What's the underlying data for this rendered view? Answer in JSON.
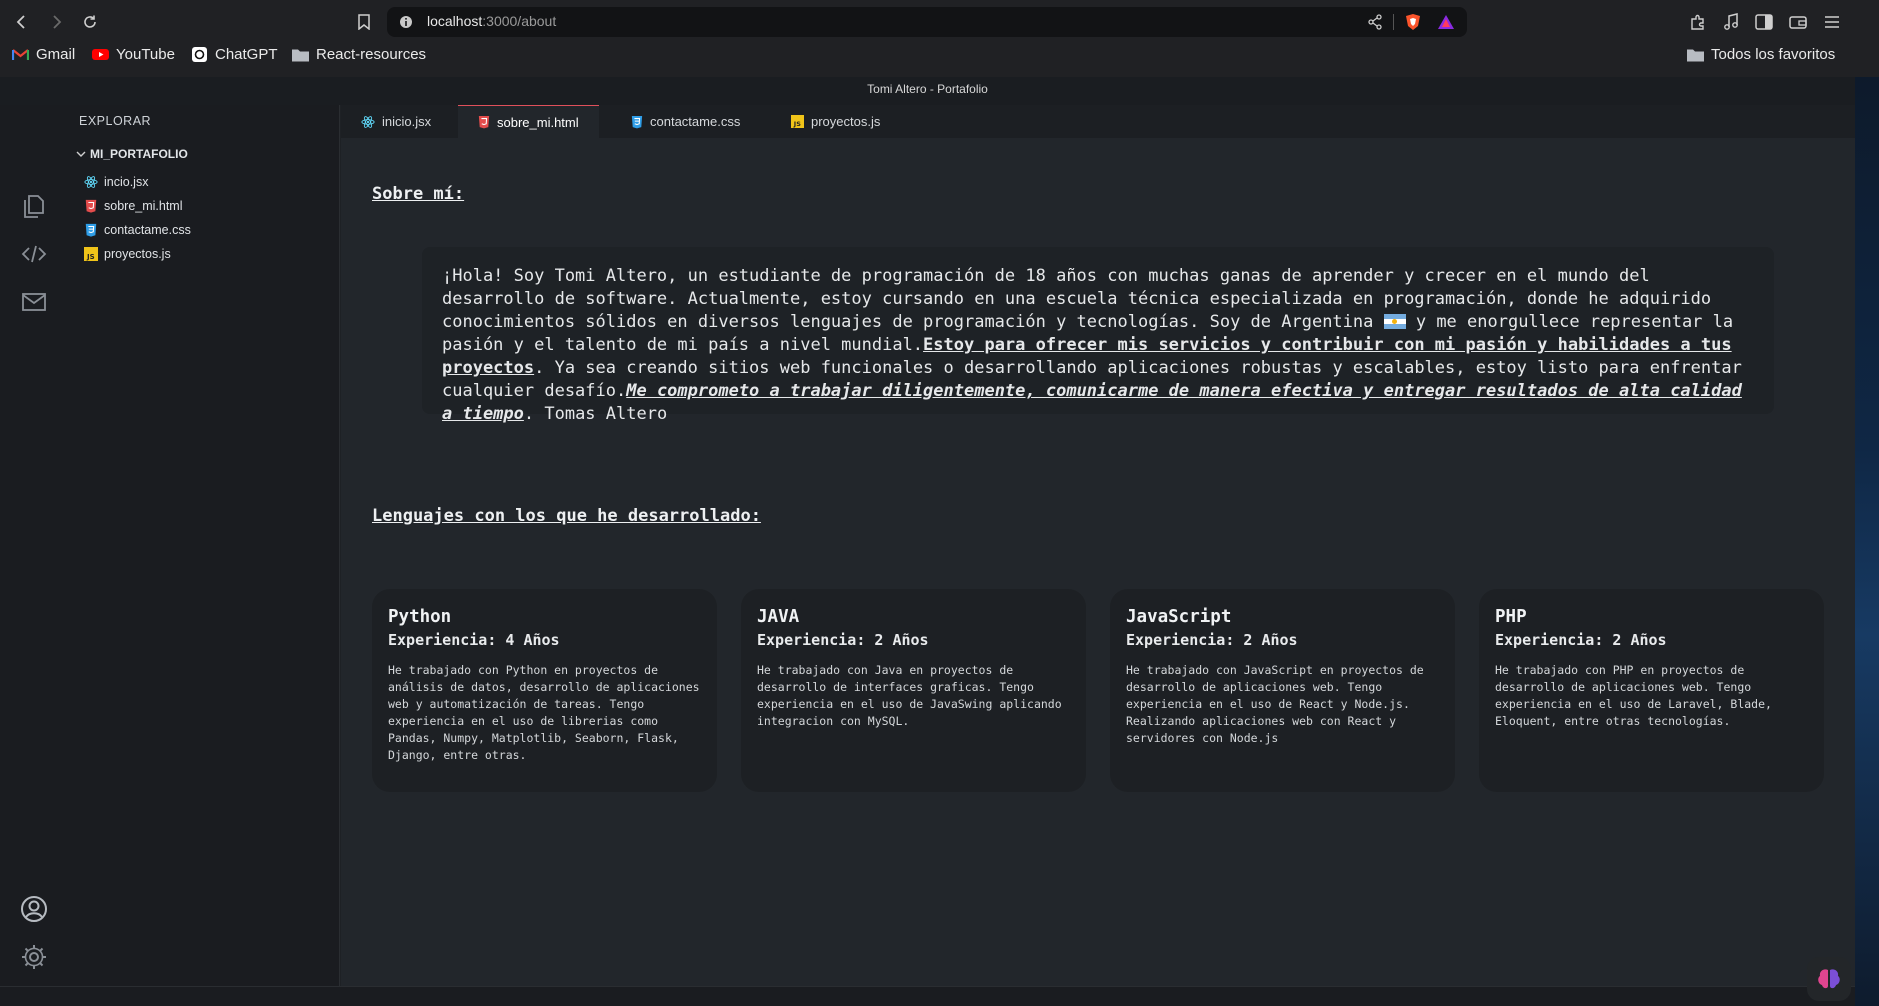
{
  "browser": {
    "url_host": "localhost",
    "url_path": ":3000/about",
    "bookmarks": [
      {
        "label": "Gmail",
        "icon": "gmail-icon"
      },
      {
        "label": "YouTube",
        "icon": "youtube-icon"
      },
      {
        "label": "ChatGPT",
        "icon": "chatgpt-icon"
      },
      {
        "label": "React-resources",
        "icon": "folder-icon"
      }
    ],
    "favorites_label": "Todos los favoritos"
  },
  "window": {
    "title": "Tomi Altero - Portafolio"
  },
  "sidebar": {
    "title": "EXPLORAR",
    "folder": "MI_PORTAFOLIO",
    "files": [
      {
        "label": "incio.jsx",
        "icon": "react-icon"
      },
      {
        "label": "sobre_mi.html",
        "icon": "html-icon"
      },
      {
        "label": "contactame.css",
        "icon": "css-icon"
      },
      {
        "label": "proyectos.js",
        "icon": "js-icon"
      }
    ]
  },
  "tabs": [
    {
      "label": "inicio.jsx",
      "icon": "react-icon",
      "active": false
    },
    {
      "label": "sobre_mi.html",
      "icon": "html-icon",
      "active": true
    },
    {
      "label": "contactame.css",
      "icon": "css-icon",
      "active": false
    },
    {
      "label": "proyectos.js",
      "icon": "js-icon",
      "active": false
    }
  ],
  "about": {
    "heading": "Sobre mí:",
    "text_1": "¡Hola! Soy Tomi Altero, un estudiante de programación de 18 años con muchas ganas de aprender y crecer en el mundo del desarrollo de software. Actualmente, estoy cursando en una escuela técnica especializada en programación, donde he adquirido conocimientos sólidos en diversos lenguajes de programación y tecnologías. Soy de Argentina ",
    "text_2": " y me enorgullece representar la pasión y el talento de mi país a nivel mundial.",
    "highlight_1": "Estoy para ofrecer mis servicios y contribuir con mi pasión y habilidades a tus proyectos",
    "text_3": ". Ya sea creando sitios web funcionales o desarrollando aplicaciones robustas y escalables, estoy listo para enfrentar cualquier desafío.",
    "highlight_2": "Me comprometo a trabajar diligentemente, comunicarme de manera efectiva y entregar resultados de alta calidad a tiempo",
    "text_4": ". Tomas Altero"
  },
  "languages": {
    "heading": "Lenguajes con los que he desarrollado:",
    "items": [
      {
        "name": "Python",
        "experience": "Experiencia: 4 Años",
        "description": "He trabajado con Python en proyectos de análisis de datos, desarrollo de aplicaciones web y automatización de tareas. Tengo experiencia en el uso de librerias como Pandas, Numpy, Matplotlib, Seaborn, Flask, Django, entre otras."
      },
      {
        "name": "JAVA",
        "experience": "Experiencia: 2 Años",
        "description": "He trabajado con Java en proyectos de desarrollo de interfaces graficas. Tengo experiencia en el uso de JavaSwing aplicando integracion con MySQL."
      },
      {
        "name": "JavaScript",
        "experience": "Experiencia: 2 Años",
        "description": "He trabajado con JavaScript en proyectos de desarrollo de aplicaciones web. Tengo experiencia en el uso de React y Node.js. Realizando aplicaciones web con React y servidores con Node.js"
      },
      {
        "name": "PHP",
        "experience": "Experiencia: 2 Años",
        "description": "He trabajado con PHP en proyectos de desarrollo de aplicaciones web. Tengo experiencia en el uso de Laravel, Blade, Eloquent, entre otras tecnologías."
      }
    ]
  },
  "colors": {
    "accent_tab": "#e0505b",
    "react": "#61dafb",
    "html": "#e34c4c",
    "css": "#2f9ee8",
    "js": "#f0c419"
  }
}
